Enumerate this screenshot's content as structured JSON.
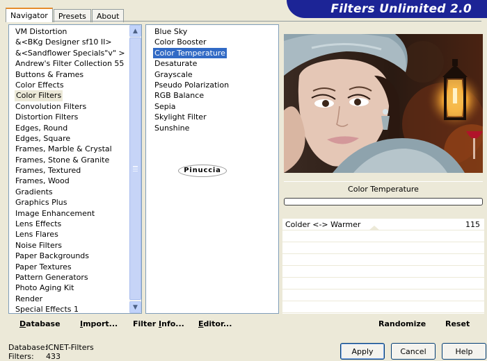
{
  "tabs": [
    "Navigator",
    "Presets",
    "About"
  ],
  "banner_title": "Filters Unlimited 2.0",
  "categories": [
    {
      "label": "VM Distortion"
    },
    {
      "label": "&<BKg Designer sf10 II>"
    },
    {
      "label": "&<Sandflower Specials\"v\" >"
    },
    {
      "label": "Andrew's Filter Collection 55"
    },
    {
      "label": "Buttons & Frames"
    },
    {
      "label": "Color Effects"
    },
    {
      "label": "Color Filters",
      "selected": true
    },
    {
      "label": "Convolution Filters"
    },
    {
      "label": "Distortion Filters"
    },
    {
      "label": "Edges, Round"
    },
    {
      "label": "Edges, Square"
    },
    {
      "label": "Frames, Marble & Crystal"
    },
    {
      "label": "Frames, Stone & Granite"
    },
    {
      "label": "Frames, Textured"
    },
    {
      "label": "Frames, Wood"
    },
    {
      "label": "Gradients"
    },
    {
      "label": "Graphics Plus"
    },
    {
      "label": "Image Enhancement"
    },
    {
      "label": "Lens Effects"
    },
    {
      "label": "Lens Flares"
    },
    {
      "label": "Noise Filters"
    },
    {
      "label": "Paper Backgrounds"
    },
    {
      "label": "Paper Textures"
    },
    {
      "label": "Pattern Generators"
    },
    {
      "label": "Photo Aging Kit"
    },
    {
      "label": "Render"
    },
    {
      "label": "Special Effects 1"
    }
  ],
  "filters": [
    {
      "label": "Blue Sky"
    },
    {
      "label": "Color Booster"
    },
    {
      "label": "Color Temperature",
      "selected": true
    },
    {
      "label": "Desaturate"
    },
    {
      "label": "Grayscale"
    },
    {
      "label": "Pseudo Polarization"
    },
    {
      "label": "RGB Balance"
    },
    {
      "label": "Sepia"
    },
    {
      "label": "Skylight Filter"
    },
    {
      "label": "Sunshine"
    }
  ],
  "signature": "Pinuccia",
  "filter_title": "Color Temperature",
  "control": {
    "label": "Colder <-> Warmer",
    "value": "115"
  },
  "left_buttons": {
    "database": {
      "u": "D",
      "rest": "atabase"
    },
    "import": {
      "u": "I",
      "rest": "mport..."
    },
    "filter_info": {
      "pre": "Filter ",
      "u": "I",
      "rest": "nfo..."
    },
    "editor": {
      "u": "E",
      "rest": "ditor..."
    }
  },
  "right_buttons": {
    "randomize": "Randomize",
    "reset": "Reset"
  },
  "status": {
    "db_key": "Database:",
    "db_val": "ICNET-Filters",
    "f_key": "Filters:",
    "f_val": "433"
  },
  "bottom_buttons": {
    "apply": "Apply",
    "cancel": "Cancel",
    "help": "Help"
  }
}
